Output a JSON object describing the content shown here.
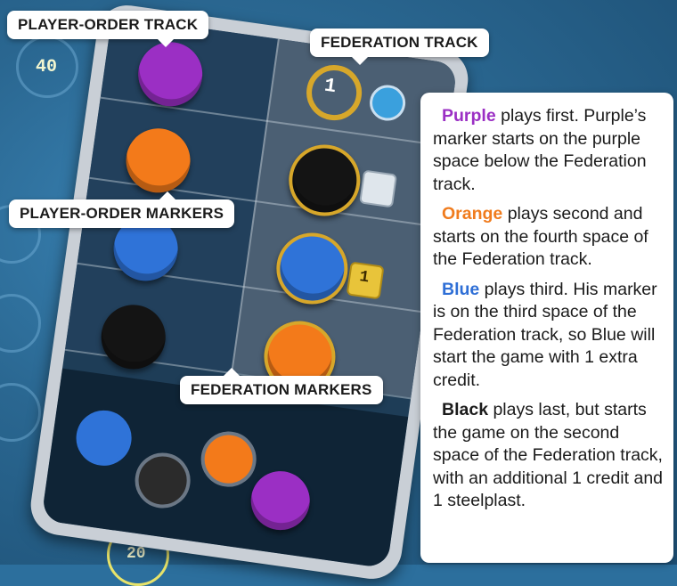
{
  "labels": {
    "player_order_track": "PLAYER-ORDER TRACK",
    "federation_track": "FEDERATION TRACK",
    "player_order_markers": "PLAYER-ORDER MARKERS",
    "federation_markers": "FEDERATION MARKERS"
  },
  "board": {
    "score_top": "40",
    "score_bottom": "20",
    "federation_bonus_1": "1",
    "federation_bonus_credit": "1"
  },
  "rules": [
    {
      "name": "Purple",
      "color": "#9b2fc4",
      "text": " plays first. Purple’s marker starts on the purple space below the Federation track."
    },
    {
      "name": "Orange",
      "color": "#f07c1e",
      "text": " plays second and starts on the fourth space of the Federation track."
    },
    {
      "name": "Blue",
      "color": "#2f6fd6",
      "text": " plays third. His marker is on the third space of the Federation track, so Blue will start the game with 1 extra credit."
    },
    {
      "name": "Black",
      "color": "#1b1b1b",
      "text": " plays last, but starts the game on the second space of the Federation track, with an additional 1 credit and 1 steelplast."
    }
  ],
  "colors": {
    "purple": "#9b2fc4",
    "orange": "#f37a1a",
    "blue": "#2f73d8",
    "black": "#141414"
  }
}
